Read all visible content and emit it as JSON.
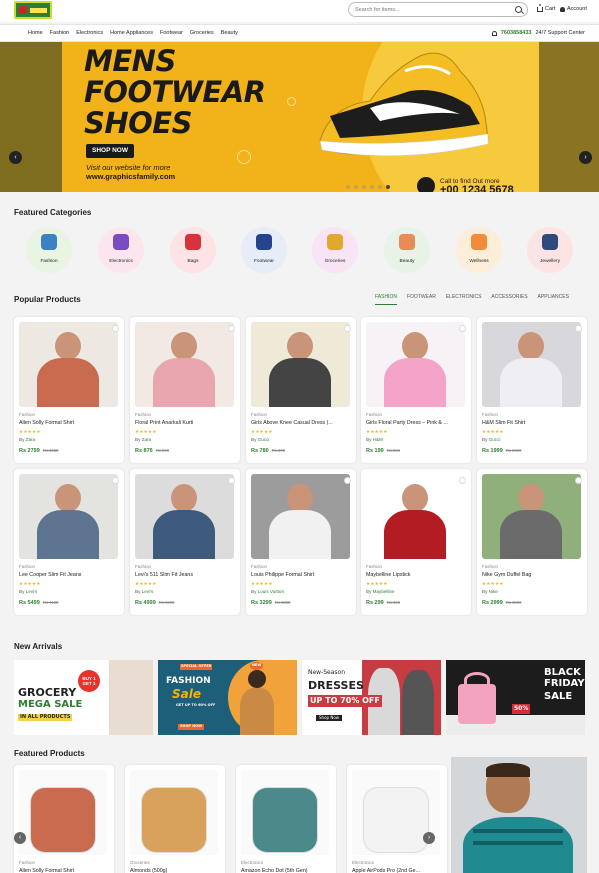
{
  "header": {
    "search_placeholder": "Search for items...",
    "cart_label": "Cart",
    "account_label": "Account",
    "phone": "7603858433",
    "support_label": "24/7 Support Center"
  },
  "nav": [
    "Home",
    "Fashion",
    "Electronics",
    "Home Appliances",
    "Footwear",
    "Groceries",
    "Beauty"
  ],
  "hero": {
    "title_line1": "MENS",
    "title_line2": "FOOTWEAR",
    "title_line3": "SHOES",
    "button": "SHOP NOW",
    "visit_line1": "Visit our website for more",
    "visit_line2": "www.graphicsfamily.com",
    "call_text": "Call to find Out more",
    "call_number": "+00 1234 5678",
    "prev_icon": "chevron-left-icon",
    "next_icon": "chevron-right-icon"
  },
  "categories": {
    "title": "Featured Categories",
    "items": [
      {
        "label": "Fashion",
        "bg": "#e9f4e3",
        "icon": "#3b82c4"
      },
      {
        "label": "Electronics",
        "bg": "#fbe6ef",
        "icon": "#7b4cc0"
      },
      {
        "label": "Bags",
        "bg": "#fde3e3",
        "icon": "#d8323e"
      },
      {
        "label": "Footwear",
        "bg": "#e6ecf8",
        "icon": "#26448e"
      },
      {
        "label": "Groceries",
        "bg": "#f8e4f4",
        "icon": "#e0a92d"
      },
      {
        "label": "Beauty",
        "bg": "#e6f3e6",
        "icon": "#e88b56"
      },
      {
        "label": "Wellness",
        "bg": "#fdeed9",
        "icon": "#f08c3a"
      },
      {
        "label": "Jewellery",
        "bg": "#fde4e4",
        "icon": "#2f4a7c"
      }
    ]
  },
  "popular": {
    "title": "Popular Products",
    "tabs": [
      "FASHION",
      "FOOTWEAR",
      "ELECTRONICS",
      "ACCESSORIES",
      "APPLIANCES"
    ],
    "products": [
      {
        "category": "Fashion",
        "name": "Allen Solly Formal Shirt",
        "brand": "Zara",
        "price": "Rs 2799",
        "old": "Rs 3499",
        "img": "#c86b4f",
        "bg": "#ede8e2"
      },
      {
        "category": "Fashion",
        "name": "Floral Print Anarkali Kurti",
        "brand": "Zara",
        "price": "Rs 876",
        "old": "Rs 999",
        "img": "#e9a6ae",
        "bg": "#f2e9e4"
      },
      {
        "category": "Fashion",
        "name": "Girls Above Knee Casual Dress (...",
        "brand": "Gucci",
        "price": "Rs 780",
        "old": "Rs 899",
        "img": "#444444",
        "bg": "#efe9d8"
      },
      {
        "category": "Fashion",
        "name": "Girls Floral Party Dress – Pink & ...",
        "brand": "H&M",
        "price": "Rs 199",
        "old": "Rs 299",
        "img": "#f4a4c8",
        "bg": "#f6f2f5"
      },
      {
        "category": "Fashion",
        "name": "H&M Slim Fit Shirt",
        "brand": "Gucci",
        "price": "Rs 1999",
        "old": "Rs 2699",
        "img": "#efeef2",
        "bg": "#d7d7dc"
      },
      {
        "category": "Fashion",
        "name": "Lee Cooper Slim Fit Jeans",
        "brand": "Levi's",
        "price": "Rs 5499",
        "old": "Rs 7199",
        "img": "#5d7590",
        "bg": "#e3e3e0"
      },
      {
        "category": "Fashion",
        "name": "Levi's 511 Slim Fit Jeans",
        "brand": "Levi's",
        "price": "Rs 4999",
        "old": "Rs 5999",
        "img": "#3e5a7c",
        "bg": "#dcdcdc"
      },
      {
        "category": "Fashion",
        "name": "Louis Philippe Formal Shirt",
        "brand": "Louis Vuitton",
        "price": "Rs 3299",
        "old": "Rs 3399",
        "img": "#f1f1f1",
        "bg": "#9c9c9c"
      },
      {
        "category": "Fashion",
        "name": "Maybelline Lipstick",
        "brand": "Maybelline",
        "price": "Rs 299",
        "old": "Rs 349",
        "img": "#b31c22",
        "bg": "#ffffff"
      },
      {
        "category": "Fashion",
        "name": "Nike Gym Duffel Bag",
        "brand": "Nike",
        "price": "Rs 2999",
        "old": "Rs 3699",
        "img": "#6b6b6b",
        "bg": "#8fb07a"
      }
    ]
  },
  "arrivals": {
    "title": "New Arrivals",
    "banners": [
      {
        "line1": "GROCERY",
        "line2": "MEGA SALE",
        "line3": "IN ALL PRODUCTS",
        "badge": "BUY 1 GET 1"
      },
      {
        "line1": "FASHION",
        "line2": "Sale",
        "line3": "GET UP TO 60% OFF",
        "badge": "NEW",
        "button": "SHOP NOW",
        "tag": "SPECIAL OFFER"
      },
      {
        "line1": "New-Season",
        "line2": "DRESSES",
        "line3": "UP TO 70% OFF",
        "button": "Shop Now"
      },
      {
        "line1": "BLACK",
        "line2": "FRIDAY",
        "line3": "SALE",
        "badge": "50%"
      }
    ]
  },
  "featured": {
    "title": "Featured Products",
    "products": [
      {
        "category": "Fashion",
        "name": "Allen Solly Formal Shirt",
        "img": "#c86b4f"
      },
      {
        "category": "Groceries",
        "name": "Almonds (500g)",
        "img": "#d8a25c"
      },
      {
        "category": "Electronics",
        "name": "Amazon Echo Dot (5th Gen)",
        "img": "#4a8a8a"
      },
      {
        "category": "Electronics",
        "name": "Apple AirPods Pro (2nd Ge...",
        "img": "#f3f3f3"
      }
    ]
  },
  "colors": {
    "brand": "#2e7d32",
    "star": "#f4b400",
    "hero": "#f2b21a"
  }
}
